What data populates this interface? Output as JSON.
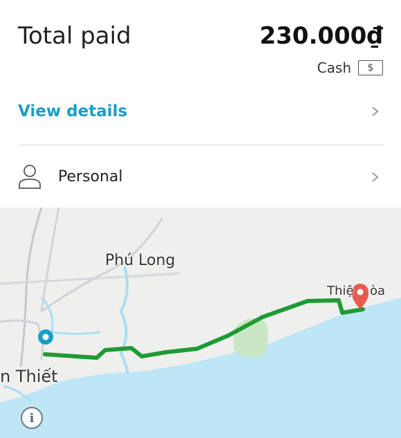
{
  "receipt": {
    "total_label": "Total paid",
    "total_amount": "230.000₫",
    "payment_method": "Cash",
    "cash_icon_glyph": "$",
    "view_details_label": "View details",
    "profile_label": "Personal"
  },
  "map": {
    "place_labels": {
      "phu_long": "Phú Long",
      "phan_thiet_partial": "n Thiết",
      "thien_hoa_left": "Thiệ",
      "thien_hoa_right": "òa"
    },
    "info_glyph": "i",
    "colors": {
      "route": "#1f9a34",
      "origin_pin": "#1a9ec4",
      "destination_pin": "#e85a4f",
      "sea": "#bfe6f7",
      "land": "#efefee",
      "park": "#c9e7c4"
    }
  },
  "colors": {
    "accent": "#1a9ec4"
  }
}
